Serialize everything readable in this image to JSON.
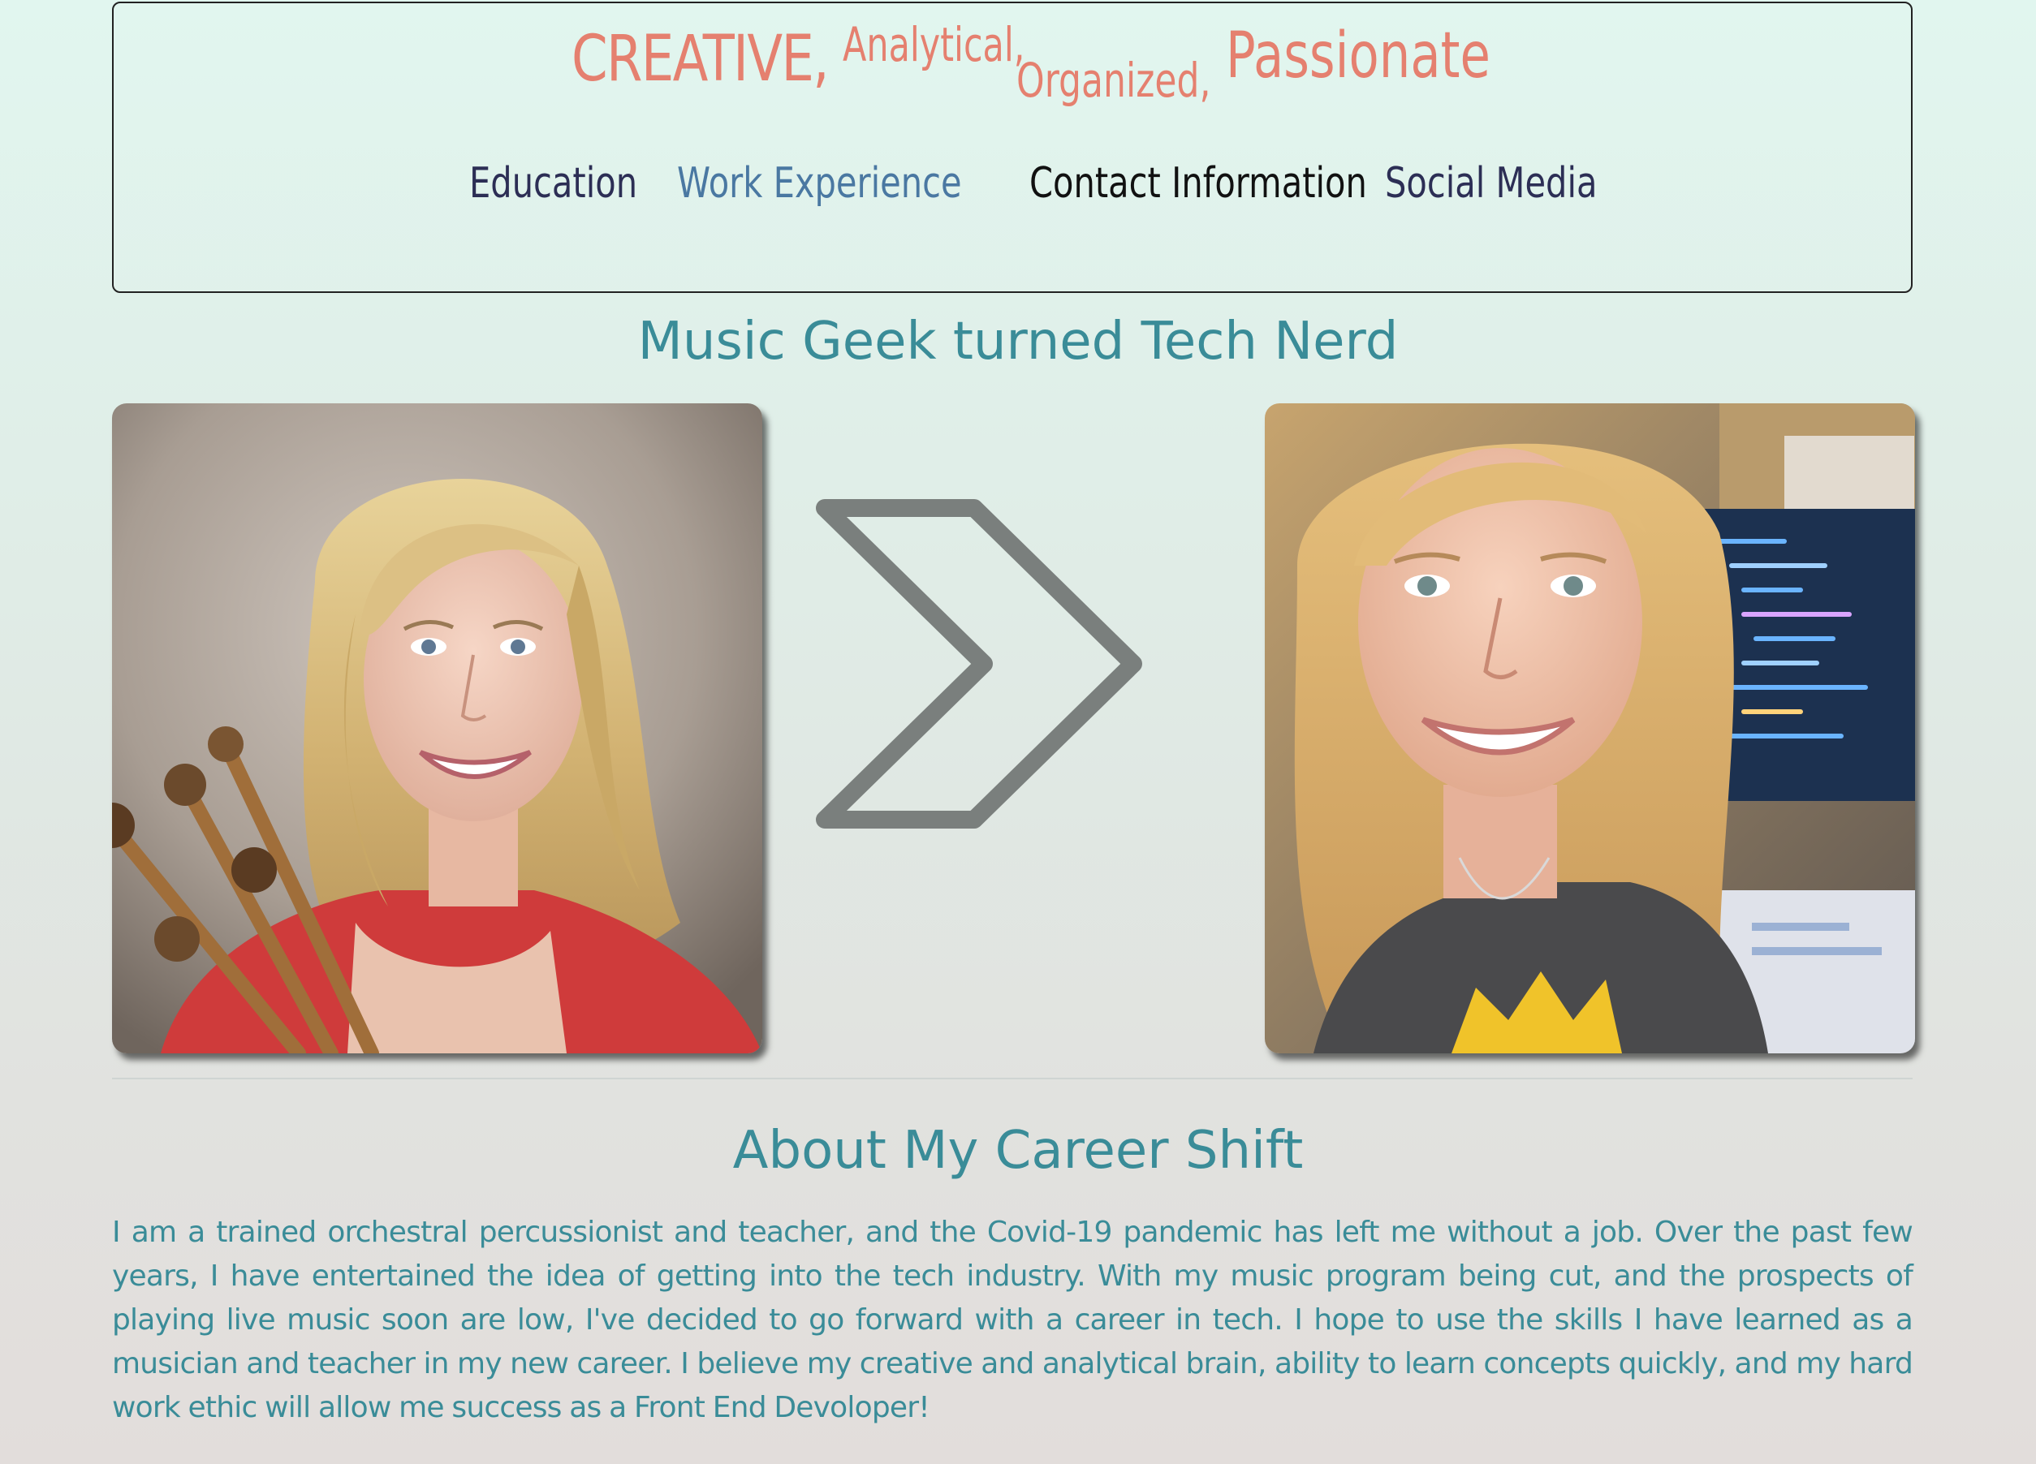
{
  "header": {
    "tagline": [
      "CREATIVE,",
      "Analytical,",
      "Organized,",
      "Passionate"
    ],
    "nav": [
      {
        "label": "Education"
      },
      {
        "label": "Work Experience"
      },
      {
        "label": "Contact Information"
      },
      {
        "label": "Social Media"
      }
    ]
  },
  "hero": {
    "title": "Music Geek turned Tech Nerd",
    "left_photo_icon": "musician-portrait-image",
    "arrow_icon": "chevron-right-icon",
    "right_photo_icon": "developer-selfie-image"
  },
  "about": {
    "title": "About My Career Shift",
    "body": "I am a trained orchestral percussionist and teacher, and the Covid-19 pandemic has left me without a job. Over the past few years, I have entertained the idea of getting into the tech industry. With my music program being cut, and the prospects of playing live music soon are low, I've decided to go forward with a career in tech. I hope to use the skills I have learned as a musician and teacher in my new career. I believe my creative and analytical brain, ability to learn concepts quickly, and my hard work ethic will allow me success as a Front End Devoloper!"
  },
  "colors": {
    "accent": "#3a8c98",
    "tagline": "#e5806f",
    "nav_dark": "#2c2e55",
    "nav_link": "#4a78a2",
    "arrow": "#7a7f7d"
  }
}
